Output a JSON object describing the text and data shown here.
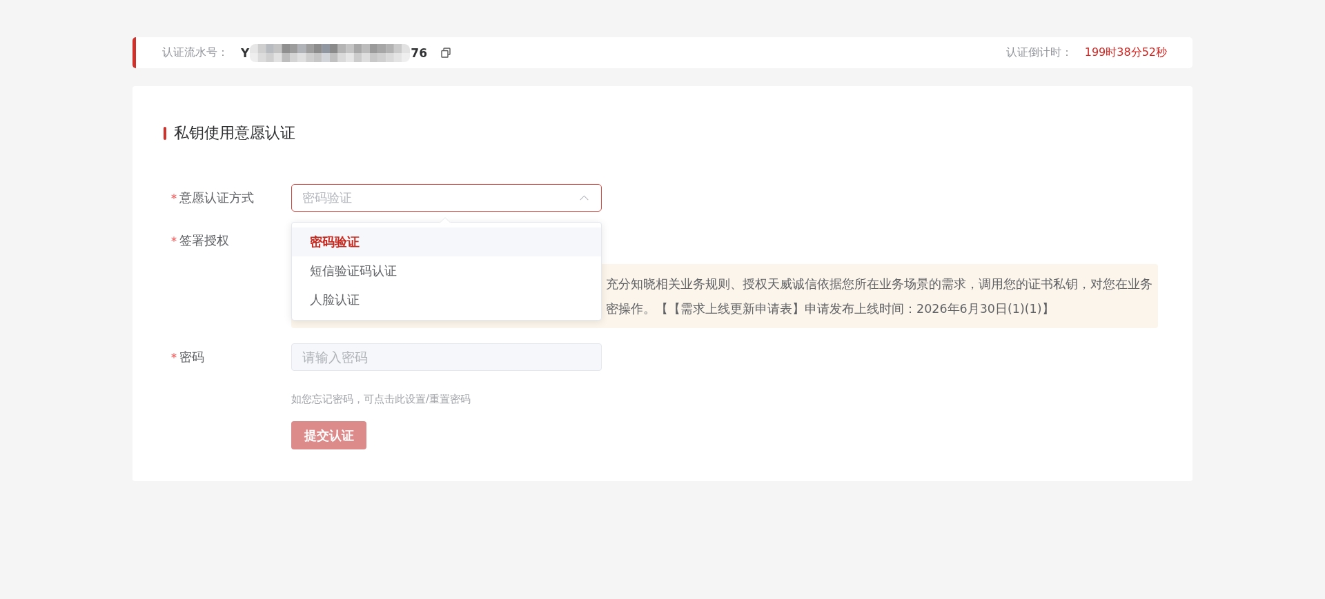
{
  "header": {
    "serial_label": "认证流水号：",
    "serial_visible_start": "Y",
    "serial_visible_end": "76",
    "countdown_label": "认证倒计时：",
    "countdown_value": "199时38分52秒"
  },
  "section": {
    "title": "私钥使用意愿认证"
  },
  "form": {
    "fields": [
      {
        "kind": "select",
        "label": "意愿认证方式",
        "required": true,
        "placeholder": "密码验证",
        "expanded": true,
        "options": [
          {
            "label": "密码验证",
            "selected": true
          },
          {
            "label": "短信验证码认证",
            "selected": false
          },
          {
            "label": "人脸认证",
            "selected": false
          }
        ]
      },
      {
        "kind": "notice",
        "label": "签署授权",
        "required": true,
        "lines": [
          "充分知晓相关业务规则、授权天威诚信依据您所在业务场景的需求，调用您的证书私钥，对您在业务",
          "密操作。【【需求上线更新申请表】申请发布上线时间：2026年6月30日(1)(1)】"
        ]
      },
      {
        "kind": "password",
        "label": "密码",
        "required": true,
        "placeholder": "请输入密码",
        "hint": "如您忘记密码，可点击此设置/重置密码"
      }
    ]
  },
  "submit_button": {
    "label": "提交认证",
    "disabled": true
  }
}
